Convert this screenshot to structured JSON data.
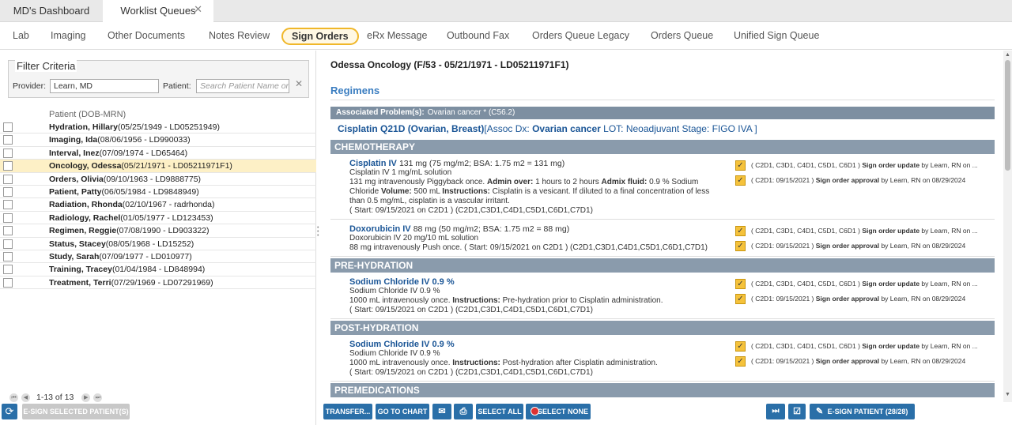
{
  "tabs": [
    {
      "label": "MD's Dashboard"
    },
    {
      "label": "Worklist Queues",
      "close": "✕"
    }
  ],
  "subnav": [
    "Lab",
    "Imaging",
    "Other Documents",
    "Notes Review",
    "Sign Orders",
    "eRx Message",
    "Outbound Fax",
    "Orders Queue Legacy",
    "Orders Queue",
    "Unified Sign Queue"
  ],
  "filter": {
    "legend": "Filter Criteria",
    "provider_label": "Provider:",
    "provider_value": "Learn, MD",
    "patient_label": "Patient:",
    "patient_placeholder": "Search Patient Name or I",
    "clear": "✕"
  },
  "patients_header": "Patient (DOB-MRN)",
  "patients": [
    {
      "name": "Hydration, Hillary",
      "info": "(05/25/1949 - LD05251949)"
    },
    {
      "name": "Imaging, Ida",
      "info": "(08/06/1956 - LD990033)"
    },
    {
      "name": "Interval, Inez",
      "info": "(07/09/1974 - LD65464)"
    },
    {
      "name": "Oncology, Odessa",
      "info": "(05/21/1971 - LD05211971F1)"
    },
    {
      "name": "Orders, Olivia",
      "info": "(09/10/1963 - LD9888775)"
    },
    {
      "name": "Patient, Patty",
      "info": "(06/05/1984 - LD9848949)"
    },
    {
      "name": "Radiation, Rhonda",
      "info": "(02/10/1967 - radrhonda)"
    },
    {
      "name": "Radiology, Rachel",
      "info": "(01/05/1977 - LD123453)"
    },
    {
      "name": "Regimen, Reggie",
      "info": "(07/08/1990 - LD903322)"
    },
    {
      "name": "Status, Stacey",
      "info": "(08/05/1968 - LD15252)"
    },
    {
      "name": "Study, Sarah",
      "info": "(07/09/1977 - LD010977)"
    },
    {
      "name": "Training, Tracey",
      "info": "(01/04/1984 - LD848994)"
    },
    {
      "name": "Treatment, Terri",
      "info": "(07/29/1969 - LD07291969)"
    }
  ],
  "pager": {
    "count": "1-13 of 13"
  },
  "buttons": {
    "esign_selected": "E-SIGN SELECTED PATIENT(S)",
    "transfer": "TRANSFER...",
    "goto_chart": "GO TO CHART",
    "select_all": "SELECT ALL",
    "select_none": "SELECT NONE",
    "esign_patient": "E-SIGN PATIENT (28/28)"
  },
  "patient_title": "Odessa Oncology (F/53 - 05/21/1971 - LD05211971F1)",
  "regimens_heading": "Regimens",
  "associated_problems": {
    "label": "Associated Problem(s):",
    "value": "Ovarian cancer * (C56.2)"
  },
  "regimen": {
    "name": "Cisplatin Q21D (Ovarian, Breast)",
    "assoc_prefix": "[Assoc Dx:",
    "dx": "Ovarian cancer",
    "rest": "LOT: Neoadjuvant Stage: FIGO IVA ]"
  },
  "status_texts": {
    "update": "( C2D1, C3D1, C4D1, C5D1, C6D1 )",
    "update_text": "Sign order update",
    "update_by": "by Learn, RN on ...",
    "approval": "( C2D1: 09/15/2021 )",
    "approval_text": "Sign order approval",
    "approval_by": "by Learn, RN on 08/29/2024"
  },
  "sections": [
    {
      "title": "CHEMOTHERAPY",
      "orders": [
        {
          "drug": "Cisplatin IV",
          "dose": "131 mg (75 mg/m2; BSA: 1.75 m2 = 131 mg)",
          "solution": "Cisplatin IV 1 mg/mL solution",
          "l1": "131 mg intravenously Piggyback once.",
          "l1b": "Admin over:",
          "l1c": "1 hours to 2 hours",
          "l1d": "Admix fluid:",
          "l1e": "0.9 % Sodium Chloride",
          "l2a": "Volume:",
          "l2b": "500 mL",
          "l2c": "Instructions:",
          "l2d": "Cisplatin is a vesicant. If diluted to a final concentration of less than 0.5 mg/mL, cisplatin is a vascular irritant.",
          "l3": "( Start: 09/15/2021 on C2D1 ) (C2D1,C3D1,C4D1,C5D1,C6D1,C7D1)"
        },
        {
          "drug": "Doxorubicin IV",
          "dose": "88 mg (50 mg/m2; BSA: 1.75 m2 = 88 mg)",
          "solution": "Doxorubicin IV 20 mg/10 mL solution",
          "l1": "88 mg intravenously Push once. ( Start: 09/15/2021 on C2D1 ) (C2D1,C3D1,C4D1,C5D1,C6D1,C7D1)"
        }
      ]
    },
    {
      "title": "PRE-HYDRATION",
      "orders": [
        {
          "drug": "Sodium Chloride IV 0.9 %",
          "solution": "Sodium Chloride IV 0.9 %",
          "l1": "1000 mL intravenously once.",
          "l1b": "Instructions:",
          "l1c": "Pre-hydration prior to Cisplatin administration.",
          "l3": "( Start: 09/15/2021 on C2D1 ) (C2D1,C3D1,C4D1,C5D1,C6D1,C7D1)"
        }
      ]
    },
    {
      "title": "POST-HYDRATION",
      "orders": [
        {
          "drug": "Sodium Chloride IV 0.9 %",
          "solution": "Sodium Chloride IV 0.9 %",
          "l1": "1000 mL intravenously once.",
          "l1b": "Instructions:",
          "l1c": "Post-hydration after Cisplatin administration.",
          "l3": "( Start: 09/15/2021 on C2D1 ) (C2D1,C3D1,C4D1,C5D1,C6D1,C7D1)"
        }
      ]
    },
    {
      "title": "PREMEDICATIONS",
      "orders": []
    }
  ],
  "colors": {
    "accent": "#2a6fa8",
    "highlight": "#f0b729",
    "section": "#8a9bac"
  }
}
